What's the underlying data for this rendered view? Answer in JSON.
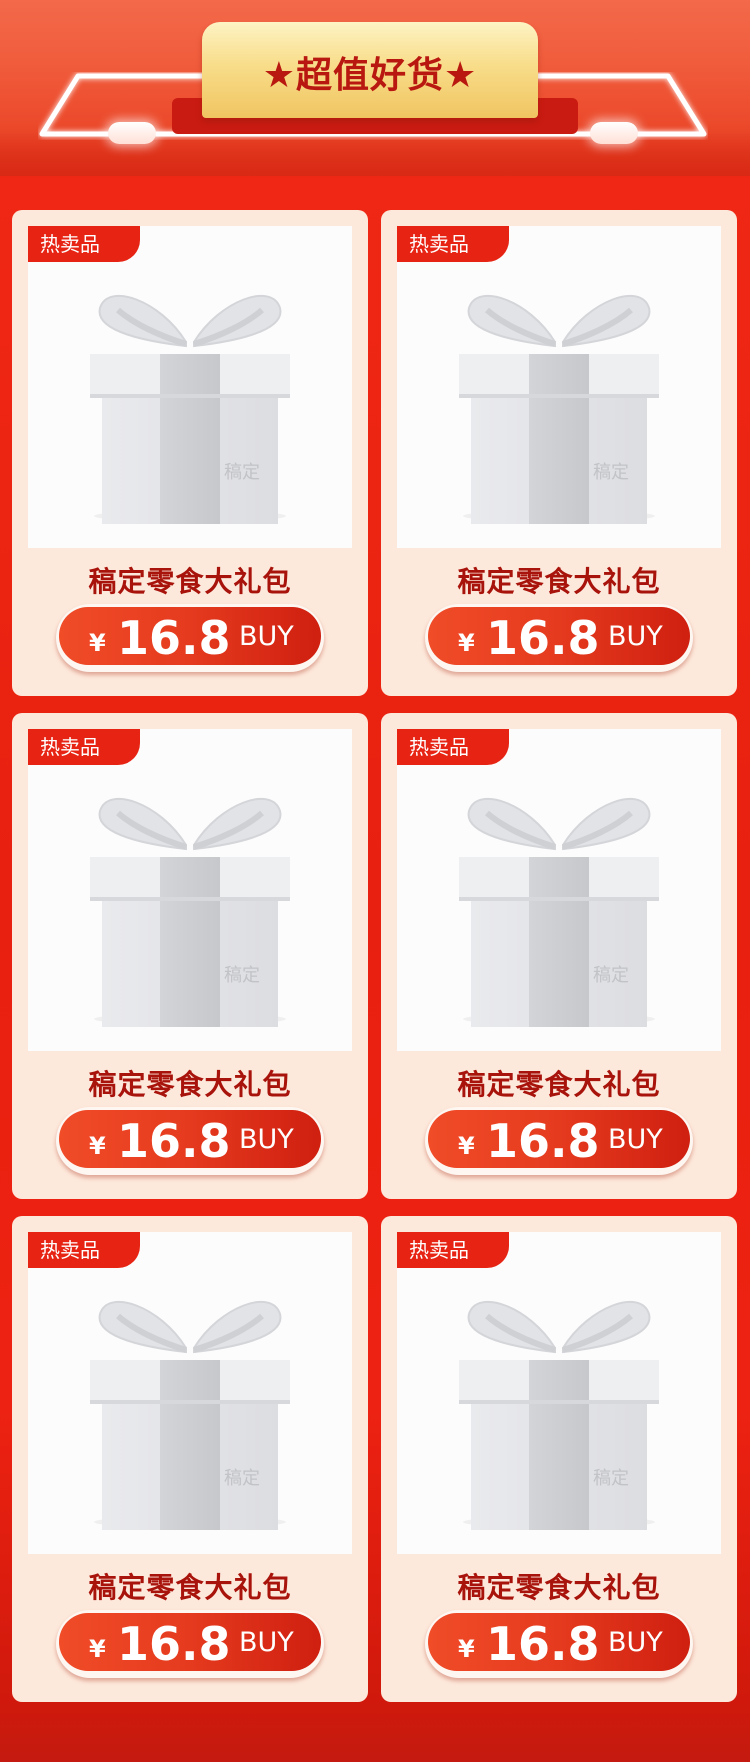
{
  "header": {
    "title": "★超值好货★"
  },
  "products": [
    {
      "tag": "热卖品",
      "watermark": "稿定",
      "name": "稿定零食大礼包",
      "currency": "¥",
      "price": "16.8",
      "buy_label": "BUY"
    },
    {
      "tag": "热卖品",
      "watermark": "稿定",
      "name": "稿定零食大礼包",
      "currency": "¥",
      "price": "16.8",
      "buy_label": "BUY"
    },
    {
      "tag": "热卖品",
      "watermark": "稿定",
      "name": "稿定零食大礼包",
      "currency": "¥",
      "price": "16.8",
      "buy_label": "BUY"
    },
    {
      "tag": "热卖品",
      "watermark": "稿定",
      "name": "稿定零食大礼包",
      "currency": "¥",
      "price": "16.8",
      "buy_label": "BUY"
    },
    {
      "tag": "热卖品",
      "watermark": "稿定",
      "name": "稿定零食大礼包",
      "currency": "¥",
      "price": "16.8",
      "buy_label": "BUY"
    },
    {
      "tag": "热卖品",
      "watermark": "稿定",
      "name": "稿定零食大礼包",
      "currency": "¥",
      "price": "16.8",
      "buy_label": "BUY"
    }
  ],
  "colors": {
    "page_red": "#e8200f",
    "card_bg": "#fde9db",
    "tag_red": "#e72414",
    "title_red": "#a8140c",
    "plaque_gold": "#f8dd8a"
  },
  "icons": {
    "gift": "gift-box-icon",
    "star": "star-icon"
  }
}
